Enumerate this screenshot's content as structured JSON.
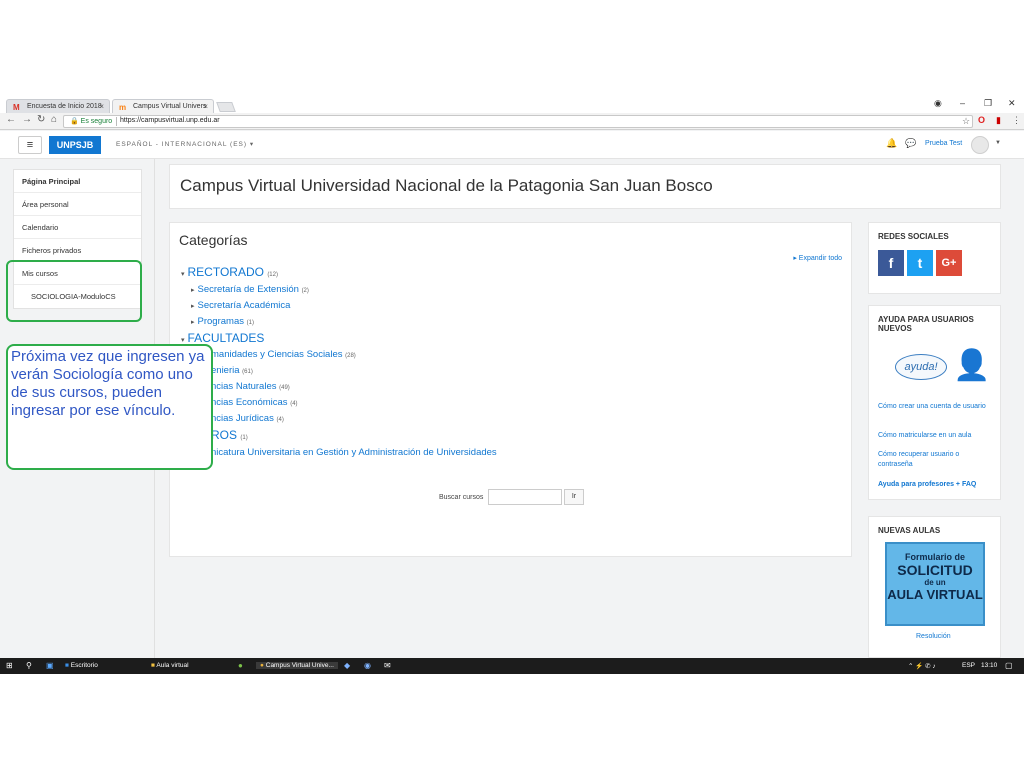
{
  "browser": {
    "tabs": [
      {
        "label": "Encuesta de Inicio 2018",
        "icon": "gmail-icon"
      },
      {
        "label": "Campus Virtual Univers",
        "icon": "moodle-icon"
      }
    ],
    "secure_label": "Es seguro",
    "url": "https://campusvirtual.unp.edu.ar"
  },
  "navbar": {
    "brand": "UNPSJB",
    "language": "ESPAÑOL - INTERNACIONAL (ES) ▾",
    "user_name": "Prueba Test"
  },
  "drawer": {
    "main_items": [
      "Página Principal",
      "Área personal",
      "Calendario",
      "Ficheros privados"
    ],
    "my_courses_label": "Mis cursos",
    "my_courses": [
      "SOCIOLOGIA-ModuloCS"
    ]
  },
  "header": {
    "title": "Campus Virtual Universidad Nacional de la Patagonia San Juan Bosco"
  },
  "categories": {
    "title": "Categorías",
    "expand_all": "Expandir todo",
    "items": [
      {
        "name": "RECTORADO",
        "count": "(12)",
        "level": 0
      },
      {
        "name": "Secretaría de Extensión",
        "count": "(2)",
        "level": 1
      },
      {
        "name": "Secretaría Académica",
        "count": "",
        "level": 1
      },
      {
        "name": "Programas",
        "count": "(1)",
        "level": 1
      },
      {
        "name": "FACULTADES",
        "count": "",
        "level": 0
      },
      {
        "name": "manidades y Ciencias Sociales",
        "count": "(28)",
        "level": 1
      },
      {
        "name": "enieria",
        "count": "(61)",
        "level": 1
      },
      {
        "name": "ncias Naturales",
        "count": "(49)",
        "level": 1
      },
      {
        "name": "ncias Económicas",
        "count": "(4)",
        "level": 1
      },
      {
        "name": "ncias Jurídicas",
        "count": "(4)",
        "level": 1
      },
      {
        "name": "ROS",
        "count": "(1)",
        "level": 0
      },
      {
        "name": "nicatura Universitaria en Gestión y Administración de Universidades",
        "count": "",
        "level": 1
      }
    ],
    "search_label": "Buscar cursos",
    "search_button": "Ir"
  },
  "blocks": {
    "social": {
      "title": "REDES SOCIALES",
      "icons": [
        "f",
        "t",
        "G+"
      ]
    },
    "help": {
      "title": "AYUDA PARA USUARIOS NUEVOS",
      "logo_text": "ayuda!",
      "links": [
        "Cómo crear una cuenta de usuario",
        "Cómo matricularse en un aula",
        "Cómo recuperar usuario o contraseña"
      ],
      "bold_link": "Ayuda para profesores + FAQ"
    },
    "new_rooms": {
      "title": "NUEVAS AULAS",
      "form_lines": [
        "Formulario de",
        "SOLICITUD",
        "de un",
        "AULA VIRTUAL"
      ],
      "link": "Resolución"
    }
  },
  "annotation": {
    "text": "Próxima vez que ingresen ya verán Sociología como uno de sus cursos, pueden ingresar por ese vínculo."
  },
  "taskbar": {
    "items": [
      "Escritorio",
      "Aula virtual",
      "Campus Virtual Unive..."
    ],
    "lang": "ESP",
    "time": "13:10"
  },
  "colors": {
    "link": "#1177d1",
    "brand": "#1177d1",
    "highlight": "#2ead4a",
    "note_text": "#3057c4"
  }
}
